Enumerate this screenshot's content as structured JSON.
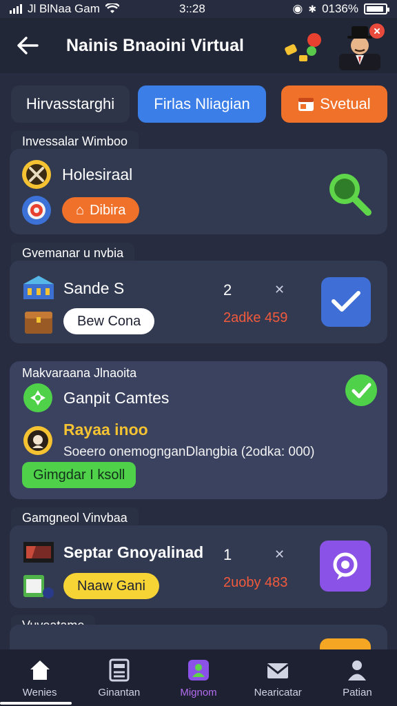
{
  "status_bar": {
    "carrier": "Jl BlNaa Gam",
    "time": "3::28",
    "battery_text": "0136%"
  },
  "header": {
    "title": "Nainis Bnaoini Virtual",
    "back_icon": "arrow-left-icon"
  },
  "tabs": [
    {
      "label": "Hirvasstarghi",
      "color": "#2f3548"
    },
    {
      "label": "Firlas Nliagian",
      "color": "#3b7ee8"
    },
    {
      "label": "Svetual",
      "color": "#f0712a",
      "icon": "calendar-icon"
    }
  ],
  "sections": [
    {
      "label": "Invessalar Wimboo",
      "title": "Holesiraal",
      "pill_label": "Dibira",
      "pill_color": "#f0712a",
      "side_icon": "magnifier-icon"
    },
    {
      "label": "Gvemanar u nvbia",
      "title": "Sande S",
      "count": "2",
      "price": "2adke 459",
      "pill_label": "Bew Cona",
      "pill_color": "#ffffff",
      "side_icon": "check-icon",
      "side_color": "#3f6fd6"
    },
    {
      "label": "Makvaraana Jlnaoita",
      "title": "Ganpit Camtes",
      "subtitle": "Rayaa inoo",
      "detail": "Soeero onemognganDlangbia (2odka: 000)",
      "pill_label": "Gimgdar I ksoll",
      "pill_color": "#4fd24a",
      "badge_icon": "check-circle-icon"
    },
    {
      "label": "Gamgneol Vinvbaa",
      "title": "Septar Gnoyalinad",
      "count": "1",
      "price": "2uoby 483",
      "pill_label": "Naaw Gani",
      "pill_color": "#f7d436",
      "side_icon": "chat-bubble-icon",
      "side_color": "#8a52e6"
    },
    {
      "label": "Vuveatame"
    }
  ],
  "bottom_nav": [
    {
      "label": "Wenies",
      "icon": "home-icon",
      "active": false
    },
    {
      "label": "Ginantan",
      "icon": "calculator-icon",
      "active": false
    },
    {
      "label": "Mignom",
      "icon": "game-icon",
      "active": true
    },
    {
      "label": "Nearicatar",
      "icon": "envelope-icon",
      "active": false
    },
    {
      "label": "Patian",
      "icon": "person-icon",
      "active": false
    }
  ]
}
